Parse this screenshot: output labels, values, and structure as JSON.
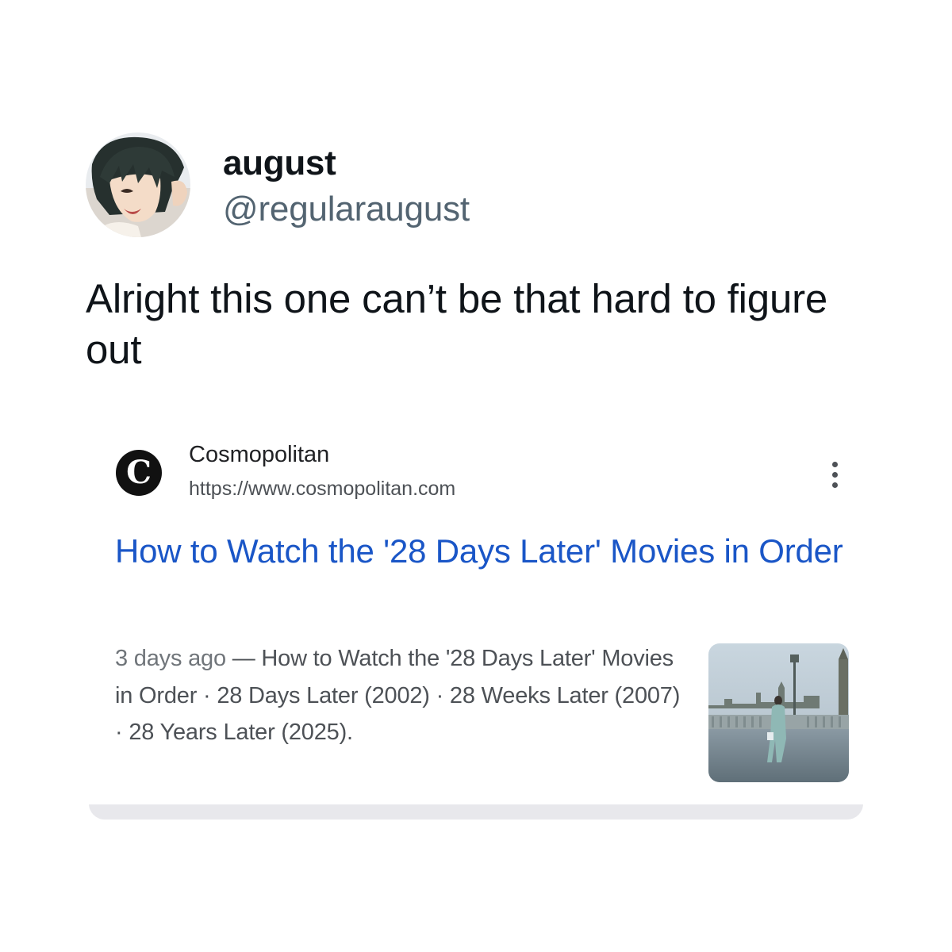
{
  "tweet": {
    "display_name": "august",
    "handle": "@regularaugust",
    "text": "Alright this one can’t be that hard to figure out"
  },
  "result": {
    "site_icon_letter": "C",
    "site_name": "Cosmopolitan",
    "site_url": "https://www.cosmopolitan.com",
    "title": "How to Watch the '28 Days Later' Movies in Order",
    "snippet_date": "3 days ago",
    "snippet_sep": " — ",
    "snippet_text": "How to Watch the '28 Days Later' Movies in Order · 28 Days Later (2002) · 28 Weeks Later (2007) · 28 Years Later (2025)."
  },
  "icons": {
    "avatar": "anime-character-avatar",
    "menu": "three-dots-vertical-icon",
    "thumbnail": "london-bridge-photo"
  },
  "colors": {
    "link": "#1a56c7",
    "handle": "#536471",
    "snippet": "#4d5156"
  }
}
